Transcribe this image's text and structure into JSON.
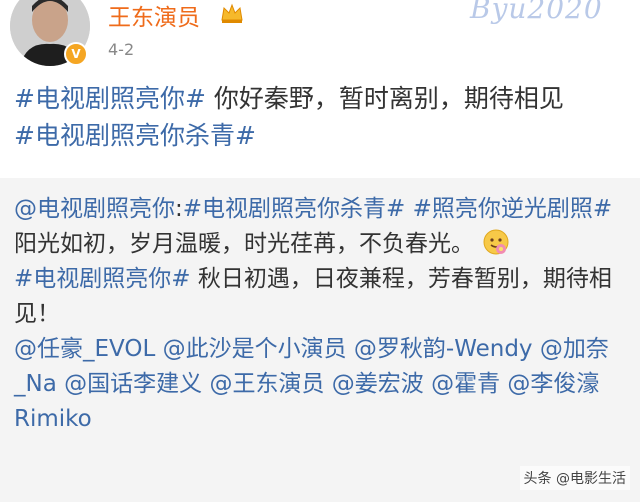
{
  "header": {
    "username": "王东演员",
    "date": "4-2",
    "stamp": "Byu2020"
  },
  "post": {
    "hashtag1": "#电视剧照亮你#",
    "text1": " 你好秦野，暂时离别，期待相见",
    "hashtag2": "#电视剧照亮你杀青#"
  },
  "repost": {
    "line1_mention": "@电视剧照亮你",
    "line1_colon": ":",
    "line1_tag1": "#电视剧照亮你杀青#",
    "line1_tag2": " #照亮你逆光剧照#",
    "line2": "阳光如初，岁月温暖，时光荏苒，不负春光。",
    "line3_tag": "#电视剧照亮你#",
    "line3_text": " 秋日初遇，日夜兼程，芳春暂别，期待相见！",
    "mentions": [
      "@任豪_EVOL",
      "@此沙是个小演员",
      "@罗秋韵-Wendy",
      "@加奈_Na",
      "@国话李建义",
      "@王东演员",
      "@姜宏波",
      "@霍青",
      "@李俊濠Rimiko"
    ]
  },
  "watermark": "头条 @电影生活",
  "colors": {
    "username": "#ef6b1a",
    "link": "#3d6aa8",
    "repost_bg": "#f4f4f4"
  },
  "icons": {
    "crown": "crown-icon",
    "verified": "verified-v-icon",
    "emoji": "flower-smile-emoji"
  }
}
